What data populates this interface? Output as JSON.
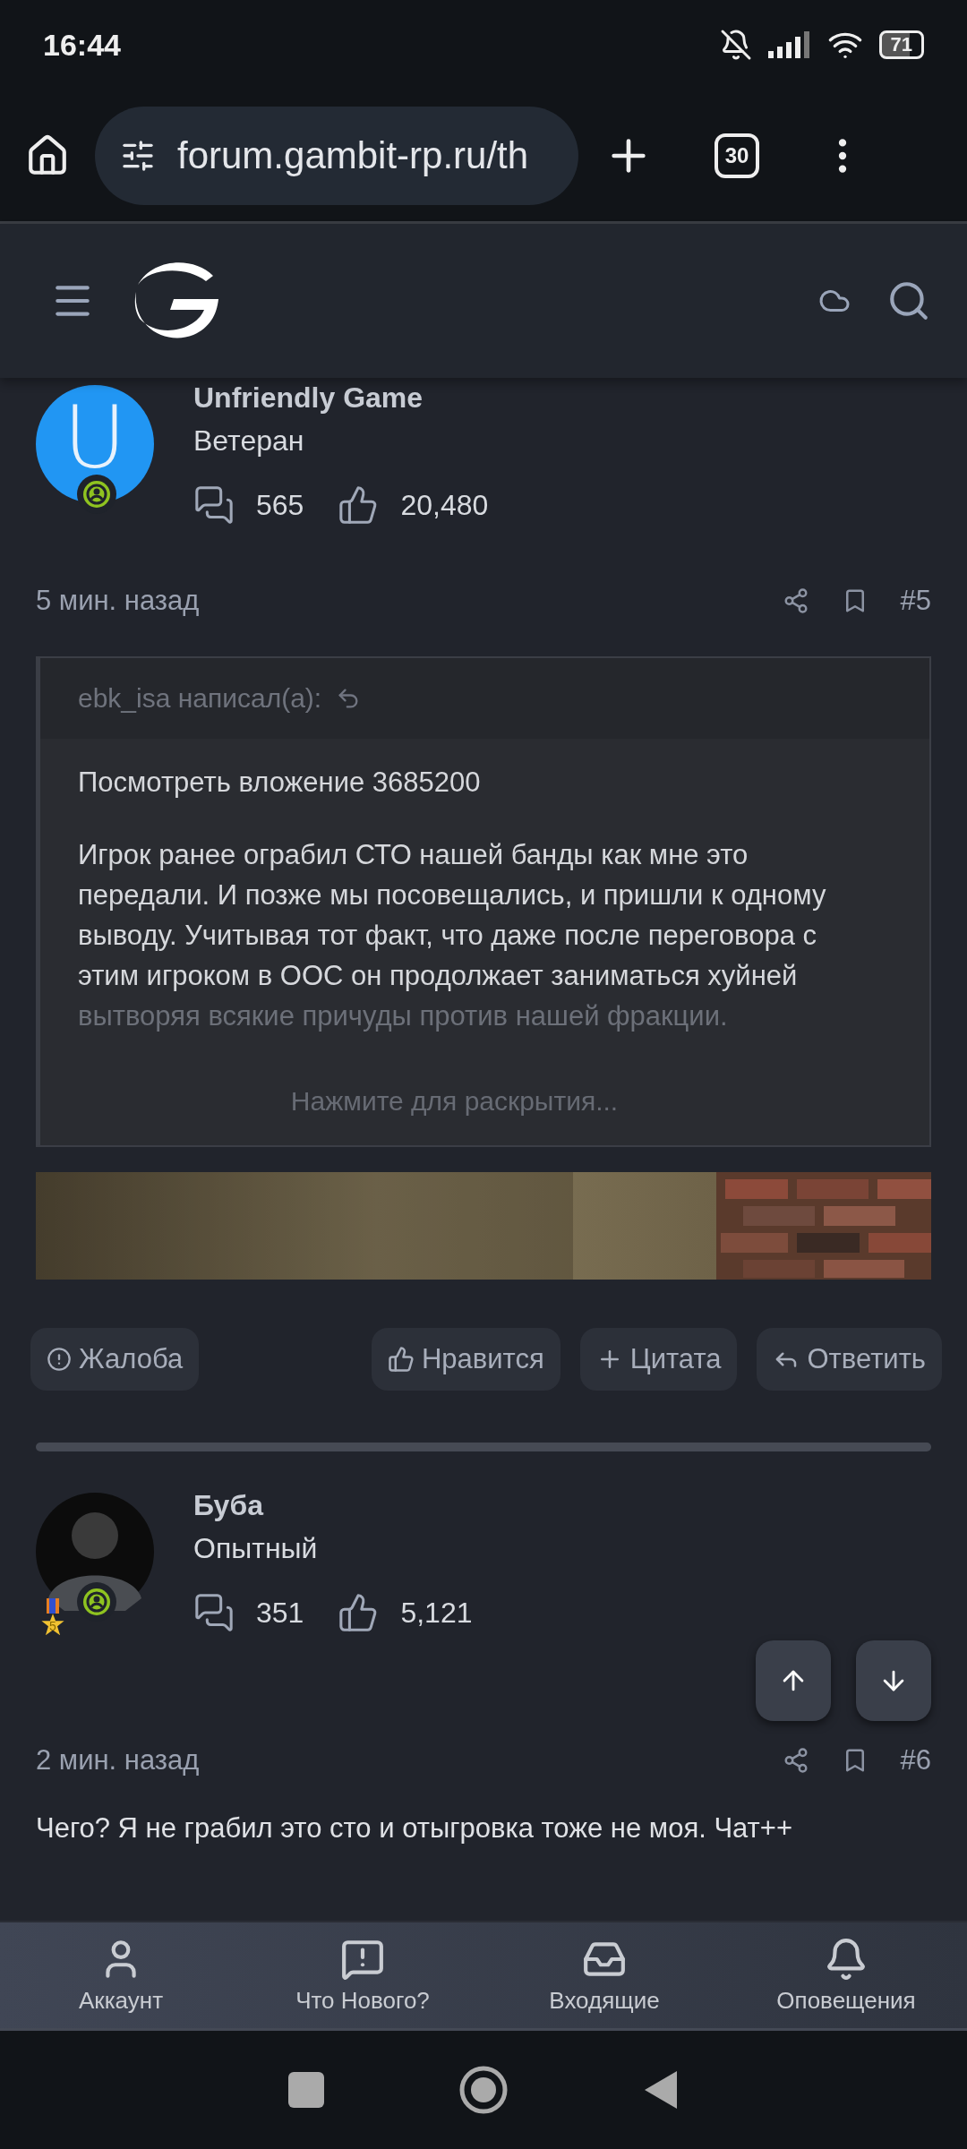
{
  "status_bar": {
    "time": "16:44",
    "battery": "71"
  },
  "browser": {
    "url": "forum.gambit-rp.ru/th",
    "tab_count": "30"
  },
  "posts": [
    {
      "author": "Unfriendly Game",
      "rank": "Ветеран",
      "avatar": {
        "kind": "letter",
        "letter": "U",
        "color": "#2196f3"
      },
      "online": true,
      "messages": "565",
      "likes": "20,480",
      "time": "5 мин. назад",
      "number": "#5",
      "quote": {
        "author": "ebk_isa написал(а):",
        "attachment": "Посмотреть вложение 3685200",
        "text": "Игрок ранее ограбил СТО нашей банды как мне это передали. И позже мы посовещались, и пришли к одному выводу. Учитывая тот факт, что даже после переговора с этим игроком в ООС он продолжает заниматься хуйней",
        "faded": "вытворяя всякие причуды против нашей фракции.",
        "expand": "Нажмите для раскрытия..."
      },
      "actions": [
        {
          "kind": "report",
          "label": "Жалоба"
        },
        {
          "kind": "like",
          "label": "Нравится"
        },
        {
          "kind": "quote",
          "label": "Цитата"
        },
        {
          "kind": "reply",
          "label": "Ответить"
        }
      ]
    },
    {
      "author": "Буба",
      "rank": "Опытный",
      "online": true,
      "medal": "5",
      "messages": "351",
      "likes": "5,121",
      "time": "2 мин. назад",
      "number": "#6",
      "body": "Чего? Я не грабил это сто и отыгровка тоже не моя. Чат++"
    }
  ],
  "bottom_nav": [
    {
      "kind": "account",
      "label": "Аккаунт"
    },
    {
      "kind": "news",
      "label": "Что Нового?"
    },
    {
      "kind": "inbox",
      "label": "Входящие"
    },
    {
      "kind": "alerts",
      "label": "Оповещения"
    }
  ]
}
